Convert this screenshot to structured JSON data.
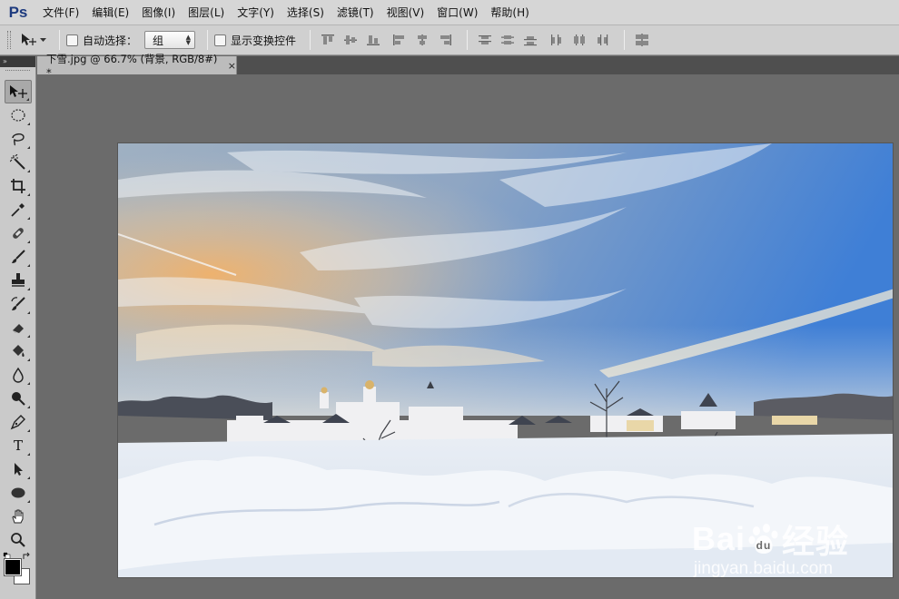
{
  "app": {
    "logo": "Ps"
  },
  "menu": [
    "文件(F)",
    "编辑(E)",
    "图像(I)",
    "图层(L)",
    "文字(Y)",
    "选择(S)",
    "滤镜(T)",
    "视图(V)",
    "窗口(W)",
    "帮助(H)"
  ],
  "options": {
    "auto_select_label": "自动选择：",
    "auto_select_value": "组",
    "show_transform_label": "显示变换控件"
  },
  "document": {
    "tab_title": "下雪.jpg @ 66.7% (背景, RGB/8#) *",
    "close": "×"
  },
  "toolbar": {
    "collapse": "»",
    "type_tool_glyph": "T"
  },
  "watermark": {
    "brand": "Bai",
    "brand2": "经验",
    "url": "jingyan.baidu.com"
  },
  "colors": {
    "foreground": "#000000",
    "background": "#ffffff"
  }
}
